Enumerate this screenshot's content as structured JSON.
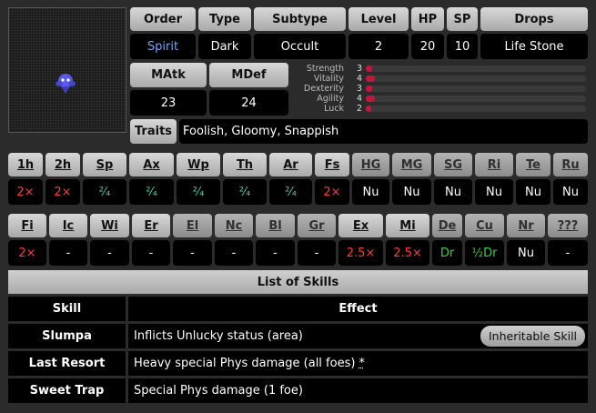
{
  "header_row": {
    "labels": [
      "Order",
      "Type",
      "Subtype",
      "Level",
      "HP",
      "SP",
      "Drops"
    ],
    "values": [
      "Spirit",
      "Dark",
      "Occult",
      "2",
      "20",
      "10",
      "Life Stone"
    ]
  },
  "magic": {
    "matk_label": "MAtk",
    "mdef_label": "MDef",
    "matk": "23",
    "mdef": "24"
  },
  "stats": [
    {
      "name": "Strength",
      "value": "3",
      "level": 3
    },
    {
      "name": "Vitality",
      "value": "4",
      "level": 4
    },
    {
      "name": "Dexterity",
      "value": "3",
      "level": 3
    },
    {
      "name": "Agility",
      "value": "4",
      "level": 4
    },
    {
      "name": "Luck",
      "value": "2",
      "level": 2
    }
  ],
  "stat_max": 99,
  "stat_color": "#c4163d",
  "traits": {
    "label": "Traits",
    "value": "Foolish, Gloomy, Snappish"
  },
  "affinities1": [
    {
      "k": "1h",
      "v": "2×",
      "c": "red"
    },
    {
      "k": "2h",
      "v": "2×",
      "c": "red"
    },
    {
      "k": "Sp",
      "v": "²⁄₄",
      "c": "teal"
    },
    {
      "k": "Ax",
      "v": "²⁄₄",
      "c": "teal"
    },
    {
      "k": "Wp",
      "v": "²⁄₄",
      "c": "teal"
    },
    {
      "k": "Th",
      "v": "²⁄₄",
      "c": "teal"
    },
    {
      "k": "Ar",
      "v": "²⁄₄",
      "c": "teal"
    },
    {
      "k": "Fs",
      "v": "2×",
      "c": "red"
    },
    {
      "k": "HG",
      "v": "Nu",
      "c": "white"
    },
    {
      "k": "MG",
      "v": "Nu",
      "c": "white"
    },
    {
      "k": "SG",
      "v": "Nu",
      "c": "white"
    },
    {
      "k": "Ri",
      "v": "Nu",
      "c": "white"
    },
    {
      "k": "Te",
      "v": "Nu",
      "c": "white"
    },
    {
      "k": "Ru",
      "v": "Nu",
      "c": "white"
    }
  ],
  "affinities2": [
    {
      "k": "Fi",
      "v": "2×",
      "c": "red"
    },
    {
      "k": "Ic",
      "v": "-",
      "c": "white"
    },
    {
      "k": "Wi",
      "v": "-",
      "c": "white"
    },
    {
      "k": "Er",
      "v": "-",
      "c": "white"
    },
    {
      "k": "El",
      "v": "-",
      "c": "white"
    },
    {
      "k": "Nc",
      "v": "-",
      "c": "white"
    },
    {
      "k": "Bl",
      "v": "-",
      "c": "white"
    },
    {
      "k": "Gr",
      "v": "-",
      "c": "white"
    },
    {
      "k": "Ex",
      "v": "2.5×",
      "c": "red"
    },
    {
      "k": "Mi",
      "v": "2.5×",
      "c": "red"
    },
    {
      "k": "De",
      "v": "Dr",
      "c": "green"
    },
    {
      "k": "Cu",
      "v": "½Dr",
      "c": "green"
    },
    {
      "k": "Nr",
      "v": "Nu",
      "c": "white"
    },
    {
      "k": "???",
      "v": "-",
      "c": "white"
    }
  ],
  "skills": {
    "title": "List of Skills",
    "col_skill": "Skill",
    "col_effect": "Effect",
    "rows": [
      {
        "name": "Slumpa",
        "effect": "Inflicts Unlucky status (area)",
        "badge": "Inheritable Skill",
        "note": ""
      },
      {
        "name": "Last Resort",
        "effect": "Heavy special Phys damage (all foes)",
        "badge": "",
        "note": "*"
      },
      {
        "name": "Sweet Trap",
        "effect": "Special Phys damage (1 foe)",
        "badge": "",
        "note": ""
      }
    ]
  }
}
